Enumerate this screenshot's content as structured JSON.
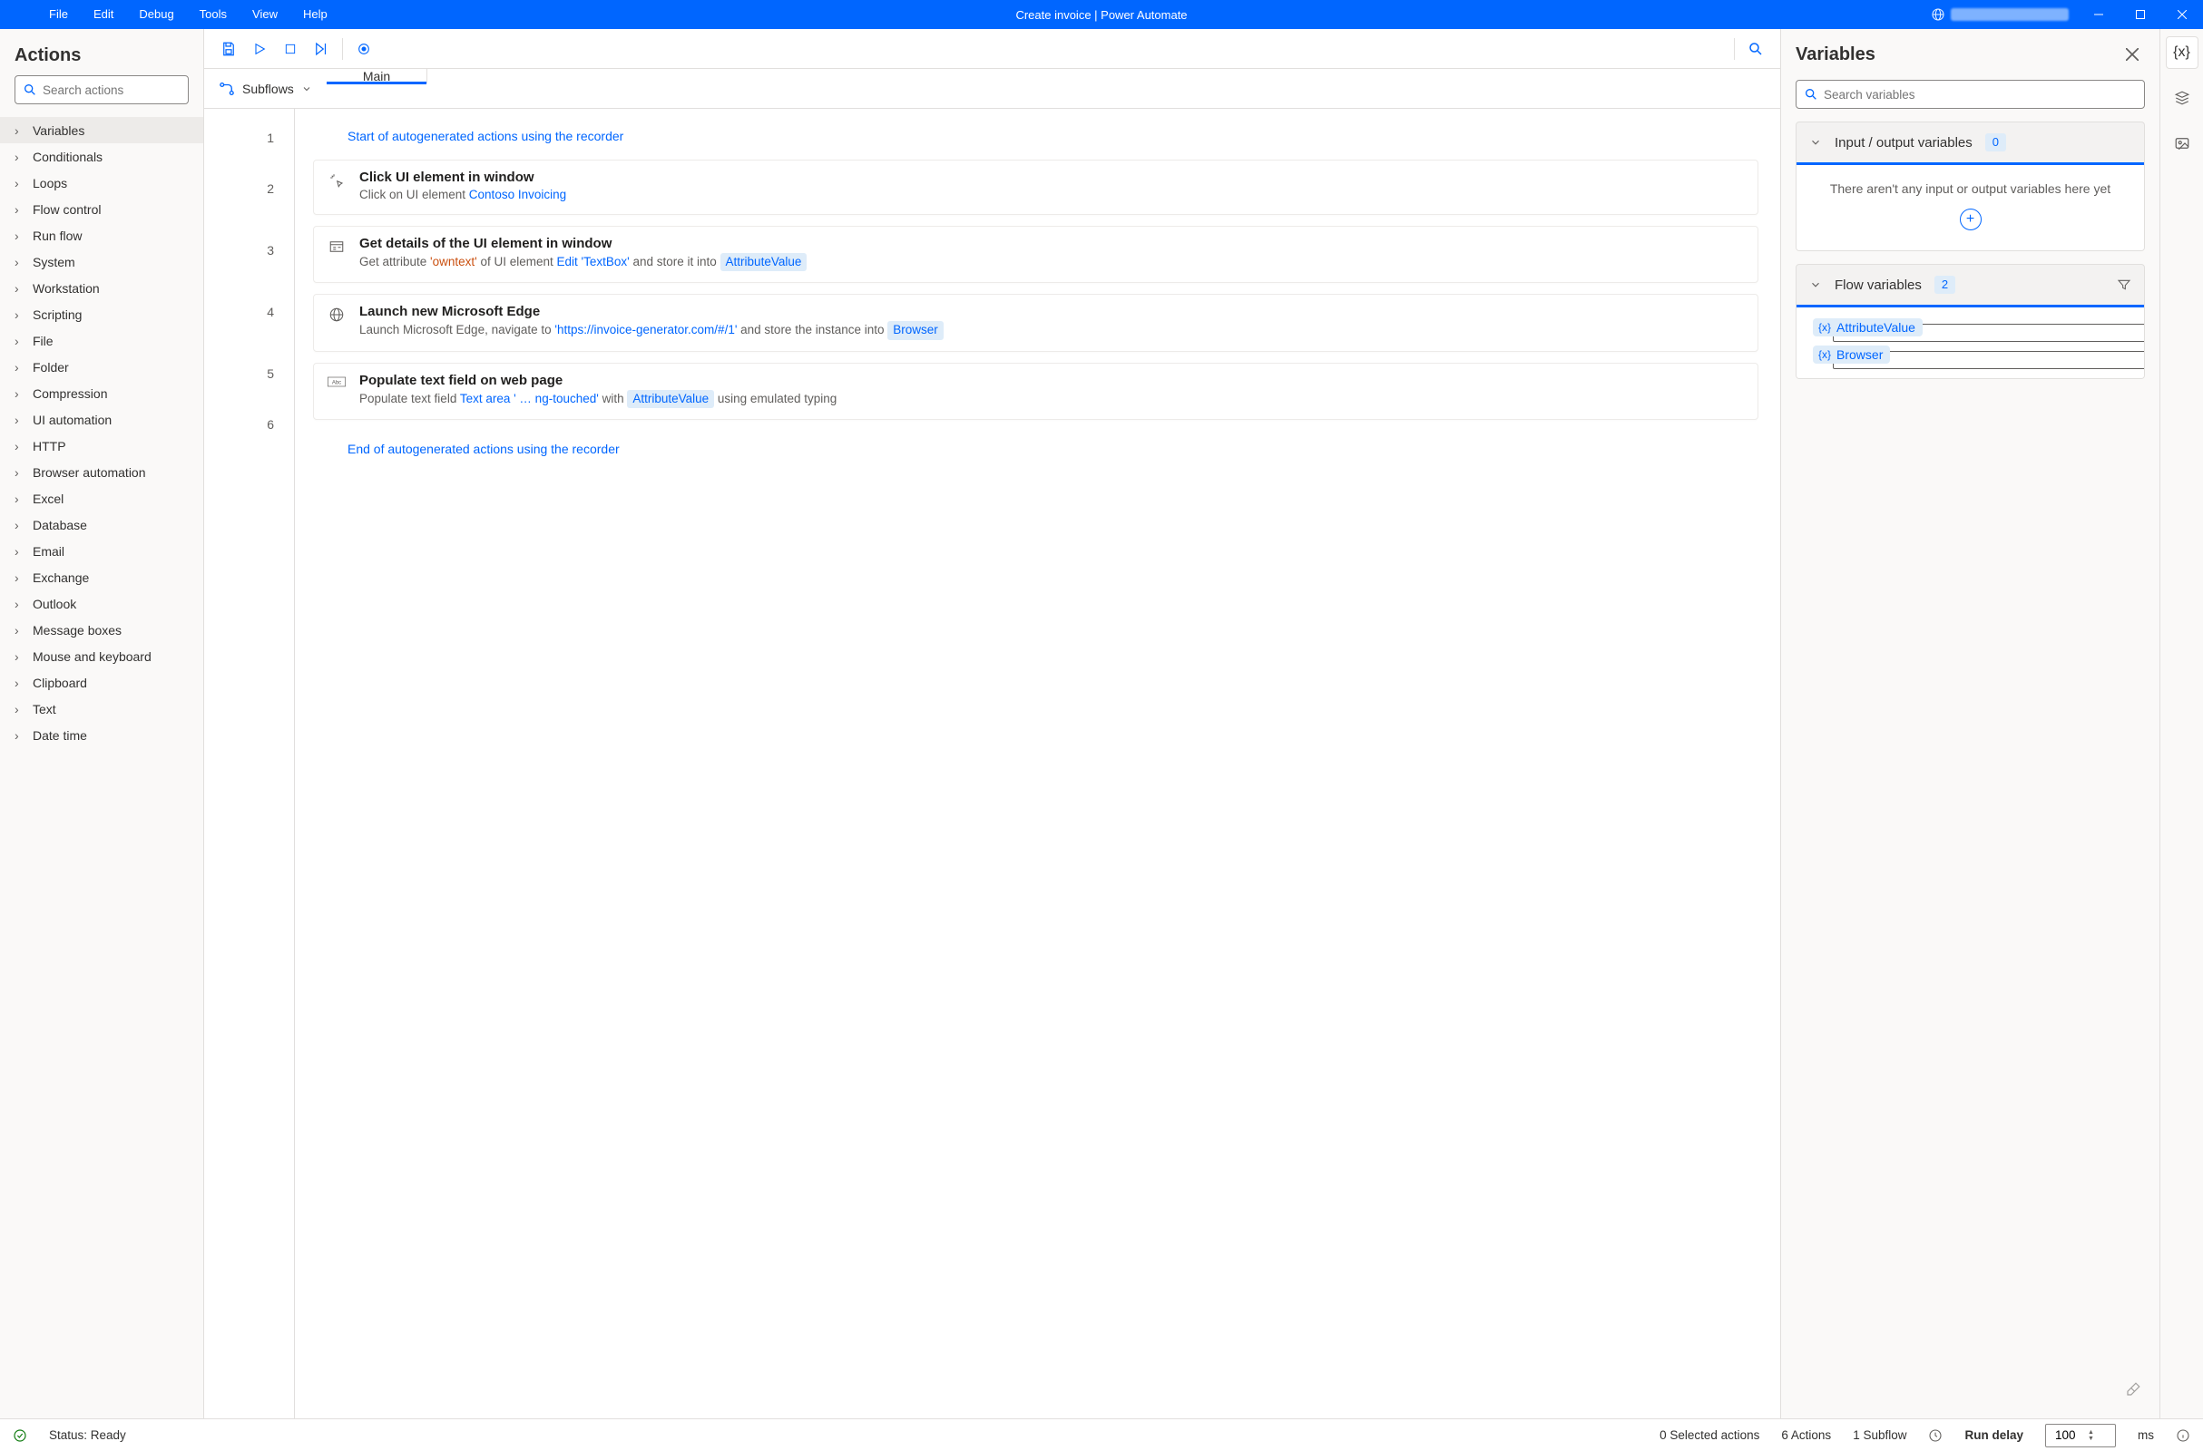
{
  "titlebar": {
    "menus": [
      "File",
      "Edit",
      "Debug",
      "Tools",
      "View",
      "Help"
    ],
    "title": "Create invoice | Power Automate"
  },
  "actions_panel": {
    "title": "Actions",
    "search_placeholder": "Search actions",
    "categories": [
      "Variables",
      "Conditionals",
      "Loops",
      "Flow control",
      "Run flow",
      "System",
      "Workstation",
      "Scripting",
      "File",
      "Folder",
      "Compression",
      "UI automation",
      "HTTP",
      "Browser automation",
      "Excel",
      "Database",
      "Email",
      "Exchange",
      "Outlook",
      "Message boxes",
      "Mouse and keyboard",
      "Clipboard",
      "Text",
      "Date time"
    ],
    "active_index": 0
  },
  "designer": {
    "subflows_label": "Subflows",
    "tabs": [
      {
        "label": "Main",
        "active": true
      }
    ],
    "steps": [
      {
        "n": 1,
        "type": "marker",
        "text": "Start of autogenerated actions using the recorder"
      },
      {
        "n": 2,
        "icon": "click",
        "name": "Click UI element in window",
        "desc_parts": [
          {
            "t": "Click on UI element "
          },
          {
            "t": "Contoso Invoicing",
            "cls": "tok-link"
          }
        ]
      },
      {
        "n": 3,
        "icon": "details",
        "name": "Get details of the UI element in window",
        "desc_parts": [
          {
            "t": "Get attribute "
          },
          {
            "t": "'owntext'",
            "cls": "tok-str"
          },
          {
            "t": " of UI element "
          },
          {
            "t": "Edit 'TextBox'",
            "cls": "tok-link"
          },
          {
            "t": " and store it into "
          },
          {
            "t": "AttributeValue",
            "cls": "tok-var"
          }
        ]
      },
      {
        "n": 4,
        "icon": "globe",
        "name": "Launch new Microsoft Edge",
        "desc_parts": [
          {
            "t": "Launch Microsoft Edge, navigate to "
          },
          {
            "t": "'https://invoice-generator.com/#/1'",
            "cls": "tok-link"
          },
          {
            "t": " and store the instance into "
          },
          {
            "t": "Browser",
            "cls": "tok-var"
          }
        ]
      },
      {
        "n": 5,
        "icon": "abc",
        "name": "Populate text field on web page",
        "desc_parts": [
          {
            "t": "Populate text field "
          },
          {
            "t": "Text area ' … ng-touched'",
            "cls": "tok-link"
          },
          {
            "t": " with "
          },
          {
            "t": "AttributeValue",
            "cls": "tok-var"
          },
          {
            "t": " using emulated typing"
          }
        ]
      },
      {
        "n": 6,
        "type": "marker",
        "text": "End of autogenerated actions using the recorder"
      }
    ]
  },
  "variables_panel": {
    "title": "Variables",
    "search_placeholder": "Search variables",
    "io_section": {
      "title": "Input / output variables",
      "count": 0,
      "empty_text": "There aren't any input or output variables here yet"
    },
    "flow_section": {
      "title": "Flow variables",
      "count": 2,
      "vars": [
        "AttributeValue",
        "Browser"
      ]
    }
  },
  "statusbar": {
    "status": "Status: Ready",
    "selected": "0 Selected actions",
    "actions": "6 Actions",
    "subflows": "1 Subflow",
    "run_delay_label": "Run delay",
    "run_delay_value": "100",
    "run_delay_unit": "ms"
  }
}
